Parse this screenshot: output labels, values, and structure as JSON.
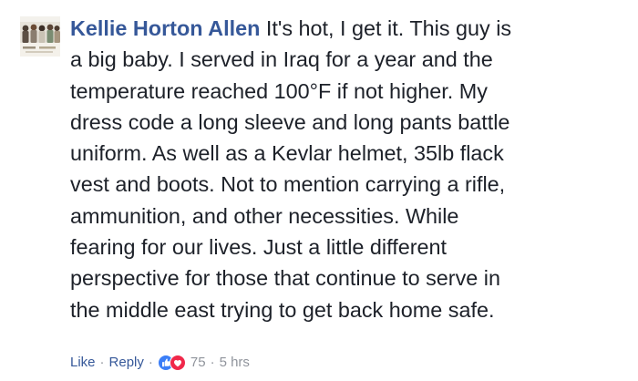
{
  "comment": {
    "author": "Kellie Horton Allen",
    "text_lines": [
      " It's hot, I get it. This guy is",
      "a big baby. I served in Iraq for a year and the",
      "temperature reached 100°F if not higher. My",
      "dress code a long sleeve and long pants battle",
      "uniform. As well as a Kevlar helmet, 35lb flack",
      "vest and boots. Not to mention carrying a rifle,",
      "ammunition, and other necessities. While",
      "fearing for our lives. Just a little different",
      "perspective for those that continue to serve in",
      "the middle east trying to get back home safe."
    ],
    "avatar_icon": "profile-photo-group",
    "actions": {
      "like_label": "Like",
      "reply_label": "Reply",
      "separator": "·",
      "reaction_icons": [
        "like-reaction-icon",
        "love-reaction-icon"
      ],
      "reaction_count": "75",
      "timestamp": "5 hrs"
    },
    "colors": {
      "author": "#365899",
      "text": "#1d2129",
      "meta": "#90949c",
      "like_blue": "#3b7ef7",
      "love_red": "#f0284a"
    }
  }
}
